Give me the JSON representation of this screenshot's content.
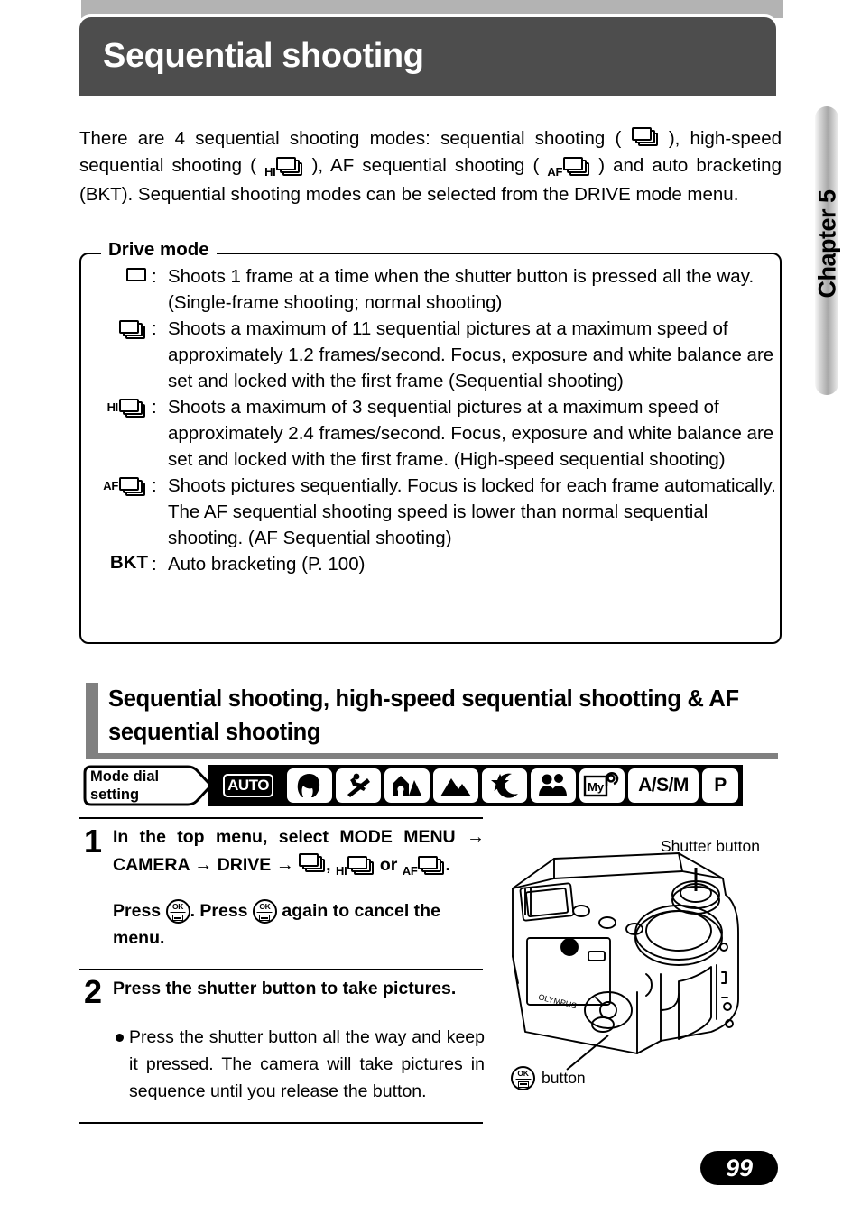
{
  "page": {
    "title": "Sequential shooting",
    "chapter_tab": "Chapter 5",
    "page_number": "99"
  },
  "intro": {
    "part1": "There are 4 sequential shooting modes: sequential shooting (",
    "part2": "), high-speed sequential shooting (",
    "part3": "), AF sequential shooting (",
    "part4": ") and auto bracketing (BKT). Sequential shooting modes can be selected from the DRIVE mode menu."
  },
  "drive_mode": {
    "legend": "Drive mode",
    "colon": ":",
    "rows": [
      {
        "icon": "single-frame-icon",
        "prefix": "",
        "text": "Shoots 1 frame at a time when the shutter button is pressed all the way. (Single-frame shooting; normal shooting)"
      },
      {
        "icon": "sequential-icon",
        "prefix": "",
        "text": "Shoots a maximum of 11 sequential pictures at a maximum speed of approximately 1.2 frames/second. Focus, exposure and white balance are set and locked with the first frame (Sequential shooting)"
      },
      {
        "icon": "high-speed-sequential-icon",
        "prefix": "HI",
        "text": "Shoots a maximum of 3 sequential pictures at a maximum speed of approximately 2.4 frames/second. Focus, exposure and white balance are set and locked with the first frame. (High-speed sequential shooting)"
      },
      {
        "icon": "af-sequential-icon",
        "prefix": "AF",
        "text": "Shoots pictures sequentially. Focus is locked for each frame automatically. The AF sequential shooting speed is lower than normal sequential shooting. (AF Sequential shooting)"
      },
      {
        "icon": "bkt-label",
        "prefix": "BKT",
        "text": "Auto bracketing (P. 100)"
      }
    ]
  },
  "section": {
    "heading": "Sequential shooting, high-speed sequential shootting & AF sequential shooting"
  },
  "mode_dial": {
    "tag_line1": "Mode dial",
    "tag_line2": "setting",
    "items": [
      {
        "name": "auto",
        "label": "AUTO",
        "type": "text-inverted"
      },
      {
        "name": "portrait",
        "label": "",
        "type": "icon"
      },
      {
        "name": "sport",
        "label": "",
        "type": "icon"
      },
      {
        "name": "landscape-portrait",
        "label": "",
        "type": "icon"
      },
      {
        "name": "landscape",
        "label": "",
        "type": "icon"
      },
      {
        "name": "night-scene",
        "label": "",
        "type": "icon"
      },
      {
        "name": "self-portrait",
        "label": "",
        "type": "icon"
      },
      {
        "name": "my-mode",
        "label": "My",
        "type": "icon"
      },
      {
        "name": "a-s-m",
        "label": "A/S/M",
        "type": "text"
      },
      {
        "name": "program",
        "label": "P",
        "type": "text"
      }
    ]
  },
  "steps": [
    {
      "number": "1",
      "line1_a": "In the top menu, select MODE MENU",
      "line1_b": "CAMERA",
      "line1_c": "DRIVE",
      "comma": ",",
      "or": "or",
      "period": ".",
      "line2_a": "Press",
      "line2_b": ". Press",
      "line2_c": "again to cancel the menu.",
      "arrow": "→"
    },
    {
      "number": "2",
      "heading": "Press the shutter button to take pictures.",
      "bullet": "Press the shutter button all the way and keep it pressed. The camera will take pictures in sequence until you release the button."
    }
  ],
  "figure": {
    "shutter_label": "Shutter button",
    "ok_label": "button"
  },
  "colors": {
    "title_bg": "#4d4d4d",
    "title_shadow": "#b3b3b3",
    "section_bar": "#808080",
    "ink": "#000000"
  }
}
